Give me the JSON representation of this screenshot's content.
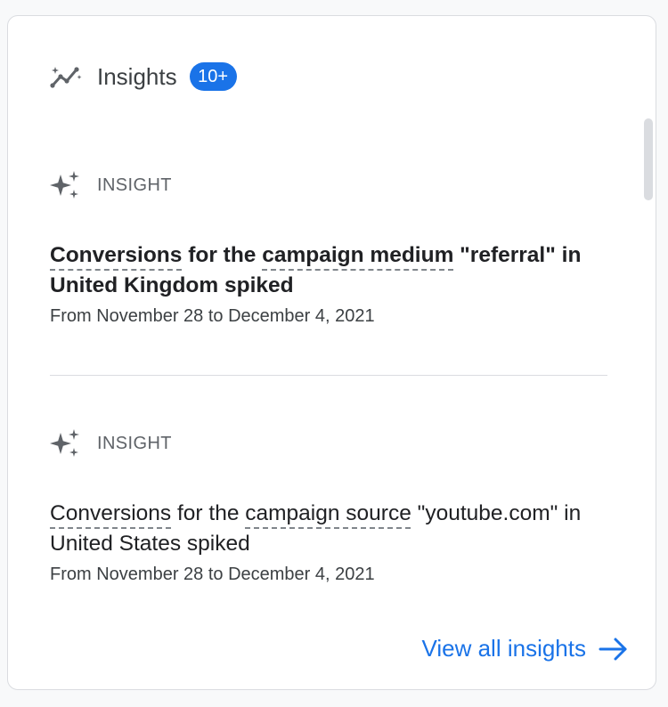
{
  "card": {
    "title": "Insights",
    "count_badge": "10+",
    "icon": "insights-trend-icon"
  },
  "insights": [
    {
      "type_label": "INSIGHT",
      "icon": "sparkle-icon",
      "title_parts": [
        "Conversions",
        " for the ",
        "campaign medium",
        " \"referral\" in United Kingdom spiked"
      ],
      "date_range": "From November 28 to December 4, 2021"
    },
    {
      "type_label": "INSIGHT",
      "icon": "sparkle-icon",
      "title_parts": [
        "Conversions",
        " for the ",
        "campaign source",
        " \"youtube.com\" in United States spiked"
      ],
      "date_range": "From November 28 to December 4, 2021"
    }
  ],
  "footer": {
    "view_all_label": "View all insights",
    "icon": "arrow-right-icon"
  },
  "colors": {
    "accent": "#1a73e8",
    "text_primary": "#202124",
    "text_secondary": "#5f6368",
    "border": "#dadce0"
  }
}
